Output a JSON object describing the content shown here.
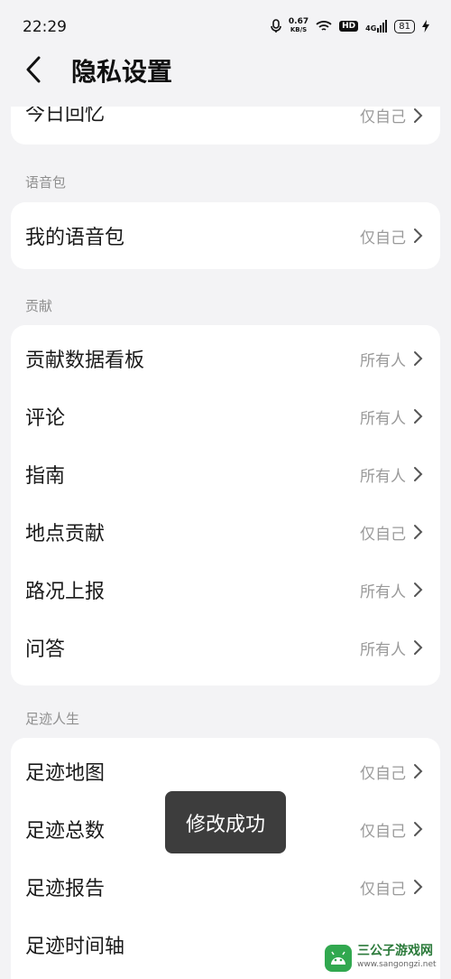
{
  "status_bar": {
    "time": "22:29",
    "net_speed_value": "0.67",
    "net_speed_unit": "KB/S",
    "hd_badge": "HD",
    "network_type": "4G",
    "battery": "81"
  },
  "header": {
    "title": "隐私设置"
  },
  "partial_row": {
    "label": "今日回忆",
    "value": "仅自己"
  },
  "sections": [
    {
      "title": "语音包",
      "rows": [
        {
          "label": "我的语音包",
          "value": "仅自己"
        }
      ]
    },
    {
      "title": "贡献",
      "rows": [
        {
          "label": "贡献数据看板",
          "value": "所有人"
        },
        {
          "label": "评论",
          "value": "所有人"
        },
        {
          "label": "指南",
          "value": "所有人"
        },
        {
          "label": "地点贡献",
          "value": "仅自己"
        },
        {
          "label": "路况上报",
          "value": "所有人"
        },
        {
          "label": "问答",
          "value": "所有人"
        }
      ]
    },
    {
      "title": "足迹人生",
      "rows": [
        {
          "label": "足迹地图",
          "value": "仅自己"
        },
        {
          "label": "足迹总数",
          "value": "仅自己"
        },
        {
          "label": "足迹报告",
          "value": "仅自己"
        },
        {
          "label": "足迹时间轴",
          "value": ""
        }
      ]
    }
  ],
  "toast": {
    "message": "修改成功"
  },
  "watermark": {
    "name": "三公子游戏网",
    "url": "www.sangongzi.net"
  }
}
